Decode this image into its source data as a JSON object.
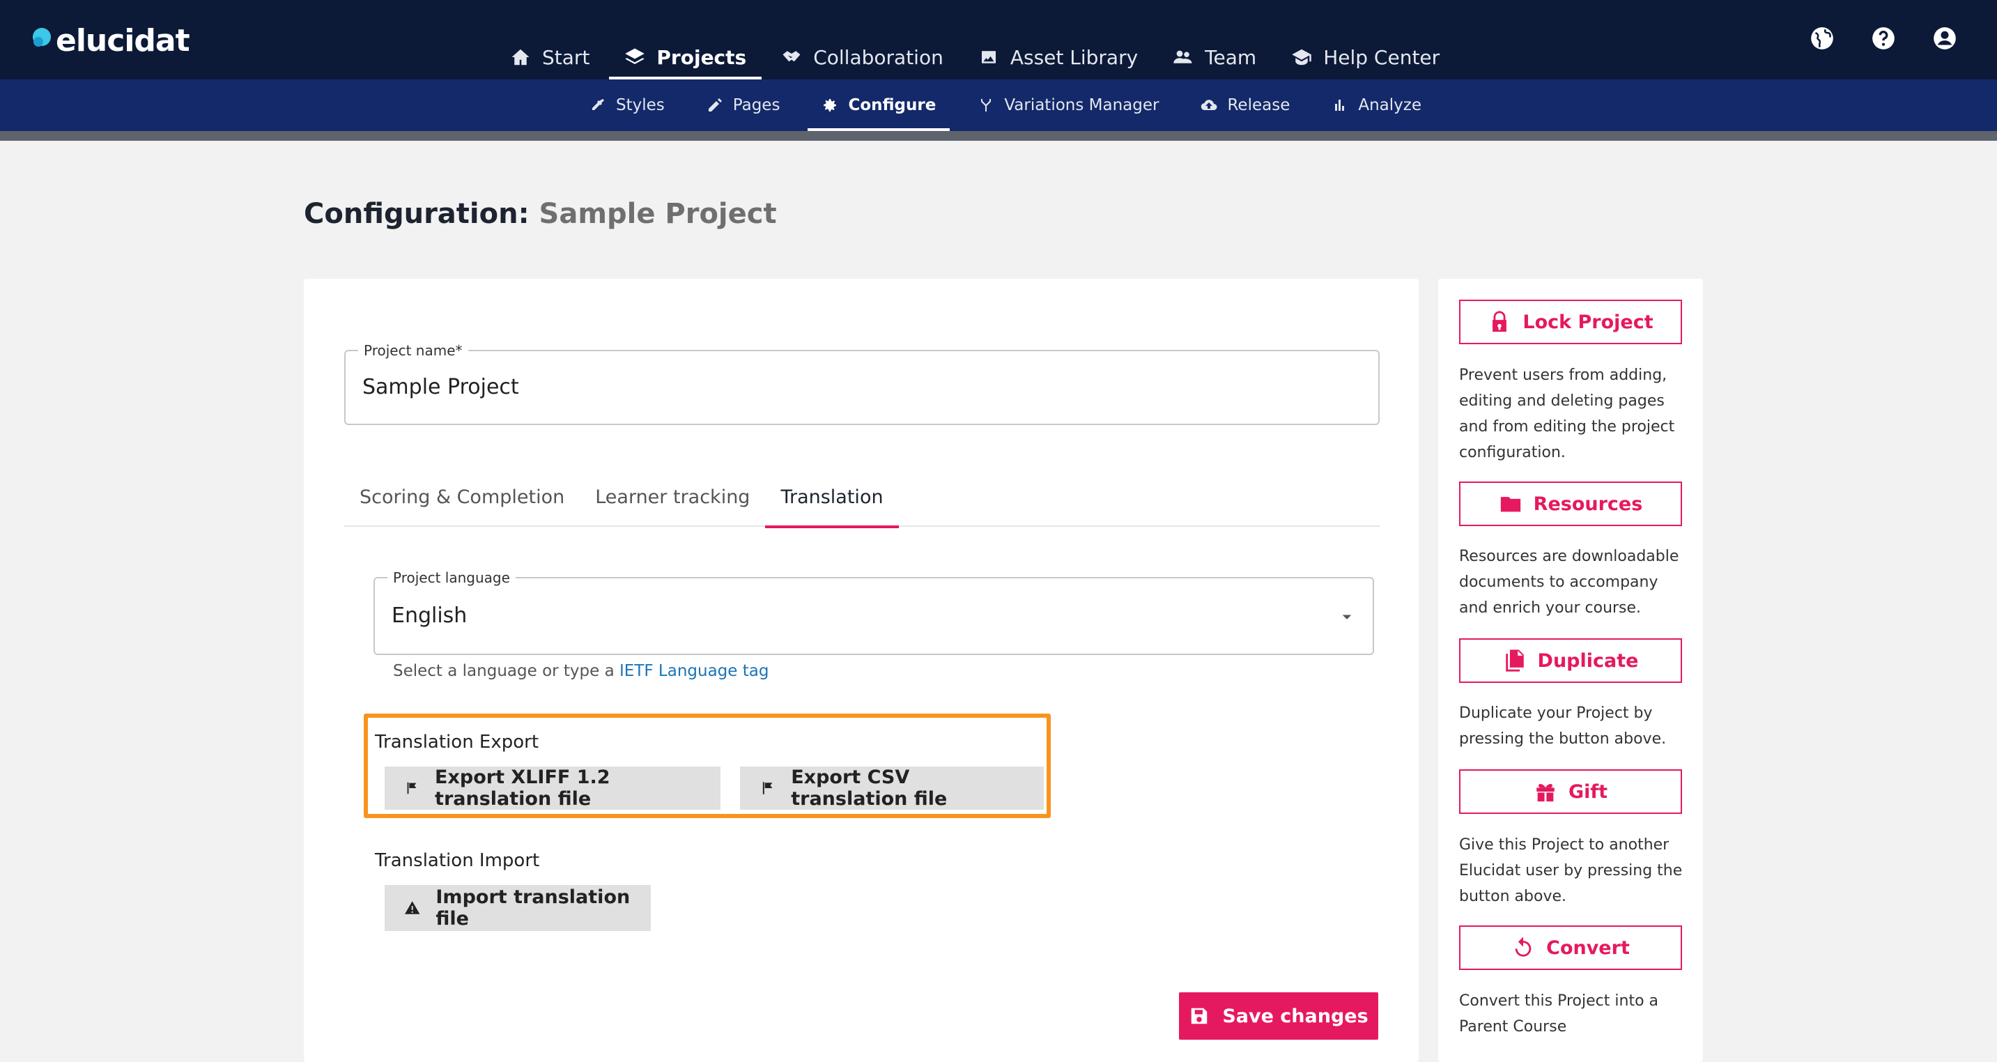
{
  "brand": {
    "name": "elucidat",
    "accent": "#e5195f",
    "nav_bg": "#0c1a38",
    "subnav_bg": "#13296a",
    "highlight": "#f7941d"
  },
  "main_nav": [
    {
      "label": "Start",
      "icon": "home-icon"
    },
    {
      "label": "Projects",
      "icon": "layers-icon",
      "active": true
    },
    {
      "label": "Collaboration",
      "icon": "handshake-icon"
    },
    {
      "label": "Asset Library",
      "icon": "images-icon"
    },
    {
      "label": "Team",
      "icon": "people-icon"
    },
    {
      "label": "Help Center",
      "icon": "graduation-cap-icon"
    }
  ],
  "utility_icons": [
    "globe-icon",
    "help-icon",
    "account-icon"
  ],
  "sub_nav": [
    {
      "label": "Styles",
      "icon": "eyedropper-icon"
    },
    {
      "label": "Pages",
      "icon": "pencil-icon"
    },
    {
      "label": "Configure",
      "icon": "gear-icon",
      "active": true
    },
    {
      "label": "Variations Manager",
      "icon": "branch-icon"
    },
    {
      "label": "Release",
      "icon": "cloud-upload-icon"
    },
    {
      "label": "Analyze",
      "icon": "bar-chart-icon"
    }
  ],
  "page": {
    "title_prefix": "Configuration:",
    "title_project": "Sample Project"
  },
  "form": {
    "project_name": {
      "label": "Project name",
      "required_mark": "*",
      "value": "Sample Project"
    },
    "tabs": [
      {
        "label": "Scoring & Completion"
      },
      {
        "label": "Learner tracking"
      },
      {
        "label": "Translation",
        "active": true
      }
    ],
    "language": {
      "label": "Project language",
      "value": "English",
      "helper_text": "Select a language or type a ",
      "helper_link": "IETF Language tag"
    },
    "export": {
      "title": "Translation Export",
      "xliff_button": "Export XLIFF 1.2 translation file",
      "csv_button": "Export CSV translation file"
    },
    "import": {
      "title": "Translation Import",
      "button": "Import translation file"
    },
    "save_button": "Save changes"
  },
  "sidebar": {
    "lock": {
      "label": "Lock Project",
      "desc": "Prevent users from adding, editing and deleting pages and from editing the project configuration."
    },
    "resources": {
      "label": "Resources",
      "desc": "Resources are downloadable documents to accompany and enrich your course."
    },
    "duplicate": {
      "label": "Duplicate",
      "desc": "Duplicate your Project by pressing the button above."
    },
    "gift": {
      "label": "Gift",
      "desc": "Give this Project to another Elucidat user by pressing the button above."
    },
    "convert": {
      "label": "Convert",
      "desc": "Convert this Project into a Parent Course"
    }
  }
}
